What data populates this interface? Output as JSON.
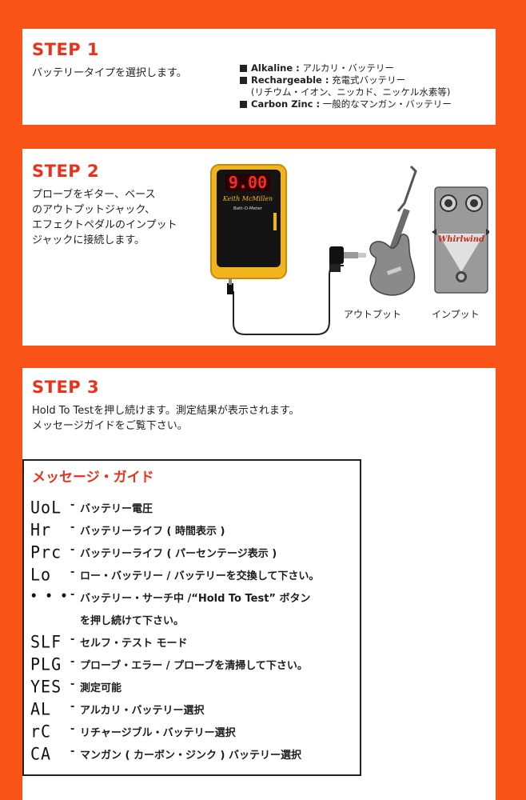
{
  "step1": {
    "heading": "STEP 1",
    "instruction": "バッテリータイプを選択します。",
    "battery_types": [
      {
        "name": "Alkaline :",
        "desc": " アルカリ・バッテリー"
      },
      {
        "name": "Rechargeable :",
        "desc": " 充電式バッテリー"
      },
      {
        "name": "",
        "desc": "(リチウム・イオン、ニッカド、ニッケル水素等)"
      },
      {
        "name": "Carbon Zinc :",
        "desc": " 一般的なマンガン・バッテリー"
      }
    ]
  },
  "step2": {
    "heading": "STEP 2",
    "instruction_lines": [
      "プローブをギター、ベース",
      "のアウトプットジャック、",
      "エフェクトペダルのインプット",
      "ジャックに接続します。"
    ],
    "meter_display": "9.00",
    "meter_brand": "Keith McMillen",
    "meter_model": "Batt-O-Meter",
    "pedal_brand": "Whirlwind",
    "caption_output": "アウトプット",
    "caption_input": "インプット"
  },
  "step3": {
    "heading": "STEP 3",
    "instruction_lines": [
      "Hold To Testを押し続けます。測定結果が表示されます。",
      "メッセージガイドをご覧下さい。"
    ],
    "guide": {
      "title": "メッセージ・ガイド",
      "items": [
        {
          "code": "UoL",
          "desc": "バッテリー電圧"
        },
        {
          "code": "Hr",
          "desc": "バッテリーライフ ( 時間表示 )"
        },
        {
          "code": "Prc",
          "desc": "バッテリーライフ ( パーセンテージ表示 )"
        },
        {
          "code": "Lo",
          "desc": "ロー・バッテリー / バッテリーを交換して下さい。"
        },
        {
          "code": "• • •",
          "desc": "バッテリー・サーチ中 /“Hold To Test” ボタン"
        },
        {
          "code": "",
          "desc": "を押し続けて下さい。"
        },
        {
          "code": "SLF",
          "desc": "セルフ・テスト モード"
        },
        {
          "code": "PLG",
          "desc": "プローブ・エラー / プローブを清掃して下さい。"
        },
        {
          "code": "YES",
          "desc": "測定可能"
        },
        {
          "code": "AL",
          "desc": "アルカリ・バッテリー選択"
        },
        {
          "code": "rC",
          "desc": "リチャージブル・バッテリー選択"
        },
        {
          "code": "CA",
          "desc": "マンガン ( カーボン・ジンク ) バッテリー選択"
        }
      ]
    }
  }
}
